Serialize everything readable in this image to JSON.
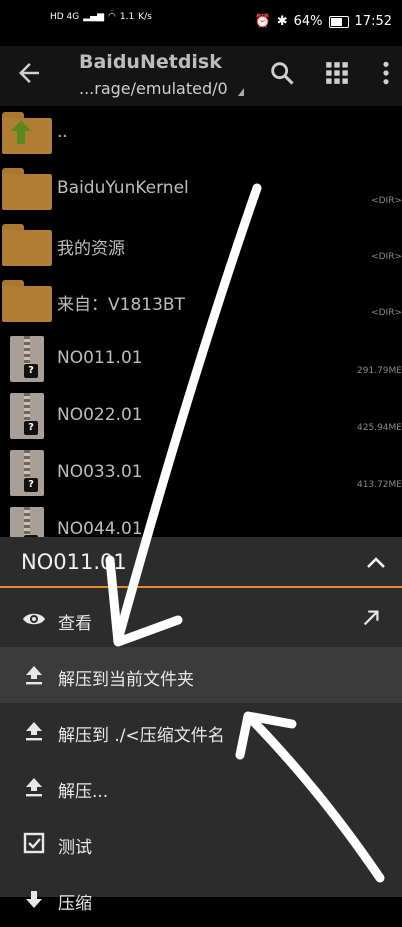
{
  "statusbar": {
    "signal_left": "HD 4G",
    "net_speed": "1.1",
    "net_unit": "K/s",
    "battery": "64%",
    "time": "17:52"
  },
  "appbar": {
    "title": "BaiduNetdisk",
    "path": "...rage/emulated/0",
    "icons": [
      "back-icon",
      "search-icon",
      "grid-icon",
      "more-icon"
    ]
  },
  "files": [
    {
      "name": "..",
      "meta": "",
      "type": "parent"
    },
    {
      "name": "BaiduYunKernel",
      "meta": "<DIR>",
      "type": "folder"
    },
    {
      "name": "我的资源",
      "meta": "<DIR>",
      "type": "folder"
    },
    {
      "name": "来自：V1813BT",
      "meta": "<DIR>",
      "type": "folder"
    },
    {
      "name": "NO011.01",
      "meta": "291.79ME",
      "type": "zip"
    },
    {
      "name": "NO022.01",
      "meta": "425.94ME",
      "type": "zip"
    },
    {
      "name": "NO033.01",
      "meta": "413.72ME",
      "type": "zip"
    },
    {
      "name": "NO044.01",
      "meta": "",
      "type": "zip"
    }
  ],
  "sheet": {
    "title": "NO011.01",
    "accent": "#e8892b",
    "items": [
      {
        "label": "查看",
        "icon": "eye-icon"
      },
      {
        "label": "解压到当前文件夹",
        "icon": "upload-icon"
      },
      {
        "label": "解压到 ./<压缩文件名",
        "icon": "upload-icon"
      },
      {
        "label": "解压...",
        "icon": "upload-icon"
      },
      {
        "label": "测试",
        "icon": "checkbox-icon"
      },
      {
        "label": "压缩",
        "icon": "download-icon"
      }
    ]
  }
}
